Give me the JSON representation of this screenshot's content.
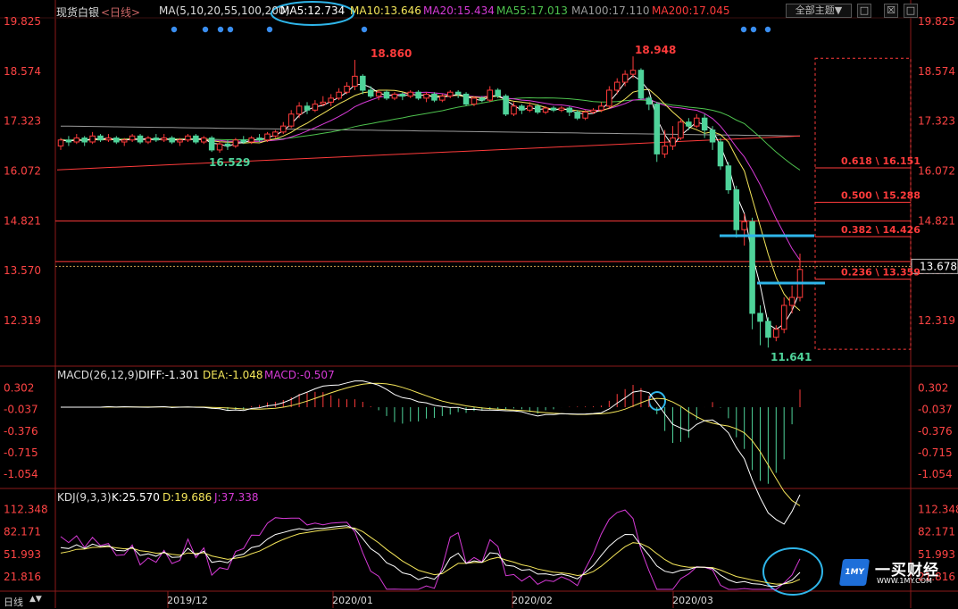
{
  "header": {
    "title": "现货白银",
    "period": "<日线>",
    "ma_label": "MA(5,10,20,55,100,200)",
    "ma5": "MA5:12.734",
    "ma10": "MA10:13.646",
    "ma20": "MA20:15.434",
    "ma55": "MA55:17.013",
    "ma100": "MA100:17.110",
    "ma200": "MA200:17.045",
    "theme_button": "全部主题▼",
    "icon_a": "□",
    "icon_b": "☒",
    "icon_c": "□"
  },
  "colors": {
    "up": "#ff3b3b",
    "down": "#4fd39a",
    "ma5": "#ffffff",
    "ma10": "#f5e65a",
    "ma20": "#d63ad6",
    "ma55": "#4ec24e",
    "ma100": "#9a9a9a",
    "ma200": "#ff3b3b",
    "annotation": "#2fb6ea",
    "axis_text": "#ff4444"
  },
  "macd": {
    "label": "MACD(26,12,9)",
    "diff": "DIFF:-1.301",
    "dea": "DEA:-1.048",
    "macd": "MACD:-0.507",
    "ticks": [
      "0.302",
      "-0.037",
      "-0.376",
      "-0.715",
      "-1.054"
    ]
  },
  "kdj": {
    "label": "KDJ(9,3,3)",
    "k": "K:25.570",
    "d": "D:19.686",
    "j": "J:37.338",
    "ticks": [
      "112.348",
      "82.171",
      "51.993",
      "21.816"
    ]
  },
  "footer": {
    "period_label": "日线",
    "arrows": "▲▼",
    "dates": [
      "2019/12",
      "2020/01",
      "2020/02",
      "2020/03"
    ]
  },
  "logo": {
    "badge": "1MY",
    "name": "一买财经",
    "url": "WWW.1MY.COM"
  },
  "chart_data": {
    "type": "candlestick",
    "y_ticks": [
      "19.825",
      "18.574",
      "17.323",
      "16.072",
      "14.821",
      "13.570",
      "12.319"
    ],
    "ylim": [
      11.4,
      19.825
    ],
    "current_price": "13.678",
    "annotations": {
      "high_1": "18.860",
      "high_2": "18.948",
      "low_1": "16.529",
      "low_2": "11.641"
    },
    "fibonacci": [
      {
        "label": "0.618 \\ 16.151",
        "value": 16.151
      },
      {
        "label": "0.500 \\ 15.288",
        "value": 15.288
      },
      {
        "label": "0.382 \\ 14.426",
        "value": 14.426
      },
      {
        "label": "0.236 \\ 13.359",
        "value": 13.359
      }
    ],
    "horizontal_lines": [
      14.821,
      13.8
    ],
    "candles": [
      [
        16.7,
        16.85,
        16.6,
        16.9
      ],
      [
        16.85,
        16.8,
        16.7,
        16.95
      ],
      [
        16.8,
        16.9,
        16.75,
        17.0
      ],
      [
        16.9,
        16.8,
        16.7,
        16.95
      ],
      [
        16.8,
        16.95,
        16.75,
        17.05
      ],
      [
        16.95,
        16.85,
        16.8,
        17.0
      ],
      [
        16.85,
        16.9,
        16.8,
        17.0
      ],
      [
        16.9,
        16.8,
        16.75,
        16.95
      ],
      [
        16.8,
        16.85,
        16.7,
        16.9
      ],
      [
        16.85,
        16.95,
        16.8,
        17.0
      ],
      [
        16.95,
        16.8,
        16.75,
        17.0
      ],
      [
        16.8,
        16.9,
        16.75,
        16.95
      ],
      [
        16.9,
        16.85,
        16.8,
        17.0
      ],
      [
        16.85,
        16.9,
        16.8,
        17.0
      ],
      [
        16.9,
        16.8,
        16.75,
        16.95
      ],
      [
        16.8,
        16.85,
        16.7,
        16.9
      ],
      [
        16.85,
        16.95,
        16.8,
        17.0
      ],
      [
        16.95,
        16.8,
        16.75,
        17.0
      ],
      [
        16.8,
        16.9,
        16.75,
        16.95
      ],
      [
        16.9,
        16.6,
        16.55,
        16.95
      ],
      [
        16.6,
        16.75,
        16.53,
        16.8
      ],
      [
        16.75,
        16.7,
        16.6,
        16.85
      ],
      [
        16.7,
        16.85,
        16.65,
        16.9
      ],
      [
        16.85,
        16.8,
        16.75,
        16.95
      ],
      [
        16.8,
        16.9,
        16.75,
        16.95
      ],
      [
        16.9,
        16.85,
        16.8,
        17.0
      ],
      [
        16.85,
        17.0,
        16.8,
        17.05
      ],
      [
        16.95,
        17.05,
        16.9,
        17.1
      ],
      [
        17.05,
        17.2,
        17.0,
        17.3
      ],
      [
        17.2,
        17.5,
        17.15,
        17.6
      ],
      [
        17.5,
        17.7,
        17.4,
        17.8
      ],
      [
        17.7,
        17.6,
        17.5,
        17.8
      ],
      [
        17.6,
        17.75,
        17.55,
        17.85
      ],
      [
        17.75,
        17.8,
        17.7,
        17.95
      ],
      [
        17.8,
        17.9,
        17.7,
        18.0
      ],
      [
        17.9,
        18.05,
        17.85,
        18.15
      ],
      [
        18.05,
        18.2,
        18.0,
        18.3
      ],
      [
        18.2,
        18.45,
        18.1,
        18.86
      ],
      [
        18.45,
        18.1,
        18.0,
        18.5
      ],
      [
        18.1,
        17.95,
        17.9,
        18.2
      ],
      [
        17.95,
        18.05,
        17.85,
        18.1
      ],
      [
        18.05,
        17.9,
        17.85,
        18.1
      ],
      [
        17.9,
        18.0,
        17.85,
        18.05
      ],
      [
        18.0,
        17.95,
        17.85,
        18.05
      ],
      [
        17.95,
        18.05,
        17.9,
        18.1
      ],
      [
        18.05,
        17.9,
        17.85,
        18.1
      ],
      [
        17.9,
        18.0,
        17.8,
        18.05
      ],
      [
        18.0,
        17.85,
        17.8,
        18.05
      ],
      [
        17.85,
        17.95,
        17.8,
        18.0
      ],
      [
        17.95,
        18.05,
        17.9,
        18.1
      ],
      [
        18.05,
        18.0,
        17.9,
        18.1
      ],
      [
        18.0,
        17.75,
        17.7,
        18.05
      ],
      [
        17.75,
        17.9,
        17.7,
        17.95
      ],
      [
        17.9,
        17.85,
        17.8,
        17.95
      ],
      [
        17.85,
        18.1,
        17.8,
        18.2
      ],
      [
        18.1,
        17.95,
        17.9,
        18.15
      ],
      [
        17.95,
        17.5,
        17.45,
        18.0
      ],
      [
        17.5,
        17.7,
        17.45,
        17.8
      ],
      [
        17.7,
        17.6,
        17.5,
        17.75
      ],
      [
        17.6,
        17.7,
        17.55,
        17.8
      ],
      [
        17.7,
        17.55,
        17.5,
        17.75
      ],
      [
        17.55,
        17.65,
        17.5,
        17.7
      ],
      [
        17.65,
        17.6,
        17.55,
        17.7
      ],
      [
        17.6,
        17.65,
        17.55,
        17.7
      ],
      [
        17.65,
        17.55,
        17.45,
        17.7
      ],
      [
        17.55,
        17.4,
        17.35,
        17.6
      ],
      [
        17.4,
        17.55,
        17.35,
        17.6
      ],
      [
        17.55,
        17.6,
        17.5,
        17.65
      ],
      [
        17.6,
        17.7,
        17.55,
        17.8
      ],
      [
        17.7,
        18.1,
        17.65,
        18.2
      ],
      [
        18.1,
        18.3,
        18.0,
        18.4
      ],
      [
        18.3,
        18.5,
        18.2,
        18.6
      ],
      [
        18.5,
        18.6,
        18.4,
        18.948
      ],
      [
        18.6,
        17.9,
        17.85,
        18.65
      ],
      [
        17.9,
        17.75,
        17.6,
        17.95
      ],
      [
        17.75,
        16.5,
        16.3,
        17.8
      ],
      [
        16.5,
        16.7,
        16.4,
        17.1
      ],
      [
        16.7,
        16.9,
        16.6,
        17.2
      ],
      [
        16.9,
        17.3,
        16.85,
        17.4
      ],
      [
        17.3,
        17.2,
        17.1,
        17.4
      ],
      [
        17.2,
        17.4,
        17.15,
        17.5
      ],
      [
        17.4,
        17.1,
        16.9,
        17.5
      ],
      [
        17.1,
        16.8,
        16.6,
        17.2
      ],
      [
        16.8,
        16.2,
        16.1,
        16.9
      ],
      [
        16.2,
        15.6,
        15.5,
        16.3
      ],
      [
        15.6,
        14.6,
        14.4,
        15.7
      ],
      [
        14.6,
        14.8,
        14.2,
        15.0
      ],
      [
        14.8,
        12.5,
        12.1,
        14.9
      ],
      [
        12.5,
        12.3,
        11.7,
        12.7
      ],
      [
        12.3,
        11.9,
        11.641,
        12.4
      ],
      [
        11.9,
        12.1,
        11.8,
        12.2
      ],
      [
        12.1,
        12.7,
        12.0,
        12.9
      ],
      [
        12.7,
        12.9,
        12.5,
        13.2
      ],
      [
        12.9,
        13.6,
        12.8,
        14.0
      ]
    ]
  }
}
